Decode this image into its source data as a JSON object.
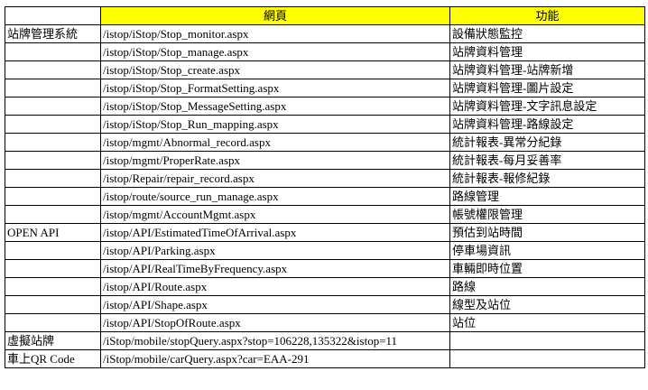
{
  "header": {
    "col1": "",
    "col2": "網頁",
    "col3": "功能"
  },
  "rows": [
    {
      "group": "站牌管理系統",
      "page": "/istop/iStop/Stop_monitor.aspx",
      "func": "設備狀態監控"
    },
    {
      "group": "",
      "page": "/istop/iStop/Stop_manage.aspx",
      "func": "站牌資料管理"
    },
    {
      "group": "",
      "page": "/istop/iStop/Stop_create.aspx",
      "func": "站牌資料管理-站牌新增"
    },
    {
      "group": "",
      "page": "/istop/iStop/Stop_FormatSetting.aspx",
      "func": "站牌資料管理-圖片設定"
    },
    {
      "group": "",
      "page": "/istop/iStop/Stop_MessageSetting.aspx",
      "func": "站牌資料管理-文字訊息設定"
    },
    {
      "group": "",
      "page": "/istop/iStop/Stop_Run_mapping.aspx",
      "func": "站牌資料管理-路線設定"
    },
    {
      "group": "",
      "page": "/istop/mgmt/Abnormal_record.aspx",
      "func": "統計報表-異常分紀錄"
    },
    {
      "group": "",
      "page": "/istop/mgmt/ProperRate.aspx",
      "func": "統計報表-每月妥善率"
    },
    {
      "group": "",
      "page": "/istop/Repair/repair_record.aspx",
      "func": "統計報表-報修紀錄"
    },
    {
      "group": "",
      "page": "/istop/route/source_run_manage.aspx",
      "func": "路線管理"
    },
    {
      "group": "",
      "page": "/istop/mgmt/AccountMgmt.aspx",
      "func": "帳號權限管理"
    },
    {
      "group": "OPEN API",
      "page": "/istop/API/EstimatedTimeOfArrival.aspx",
      "func": "預估到站時間"
    },
    {
      "group": "",
      "page": "/istop/API/Parking.aspx",
      "func": "停車場資訊"
    },
    {
      "group": "",
      "page": "/istop/API/RealTimeByFrequency.aspx",
      "func": "車輛即時位置"
    },
    {
      "group": "",
      "page": "/istop/API/Route.aspx",
      "func": "路線"
    },
    {
      "group": "",
      "page": "/istop/API/Shape.aspx",
      "func": "線型及站位"
    },
    {
      "group": "",
      "page": "/istop/API/StopOfRoute.aspx",
      "func": "站位"
    },
    {
      "group": "虛擬站牌",
      "page": "/iStop/mobile/stopQuery.aspx?stop=106228,135322&istop=11",
      "func": ""
    },
    {
      "group": "車上QR Code",
      "page": "/iStop/mobile/carQuery.aspx?car=EAA-291",
      "func": ""
    }
  ]
}
